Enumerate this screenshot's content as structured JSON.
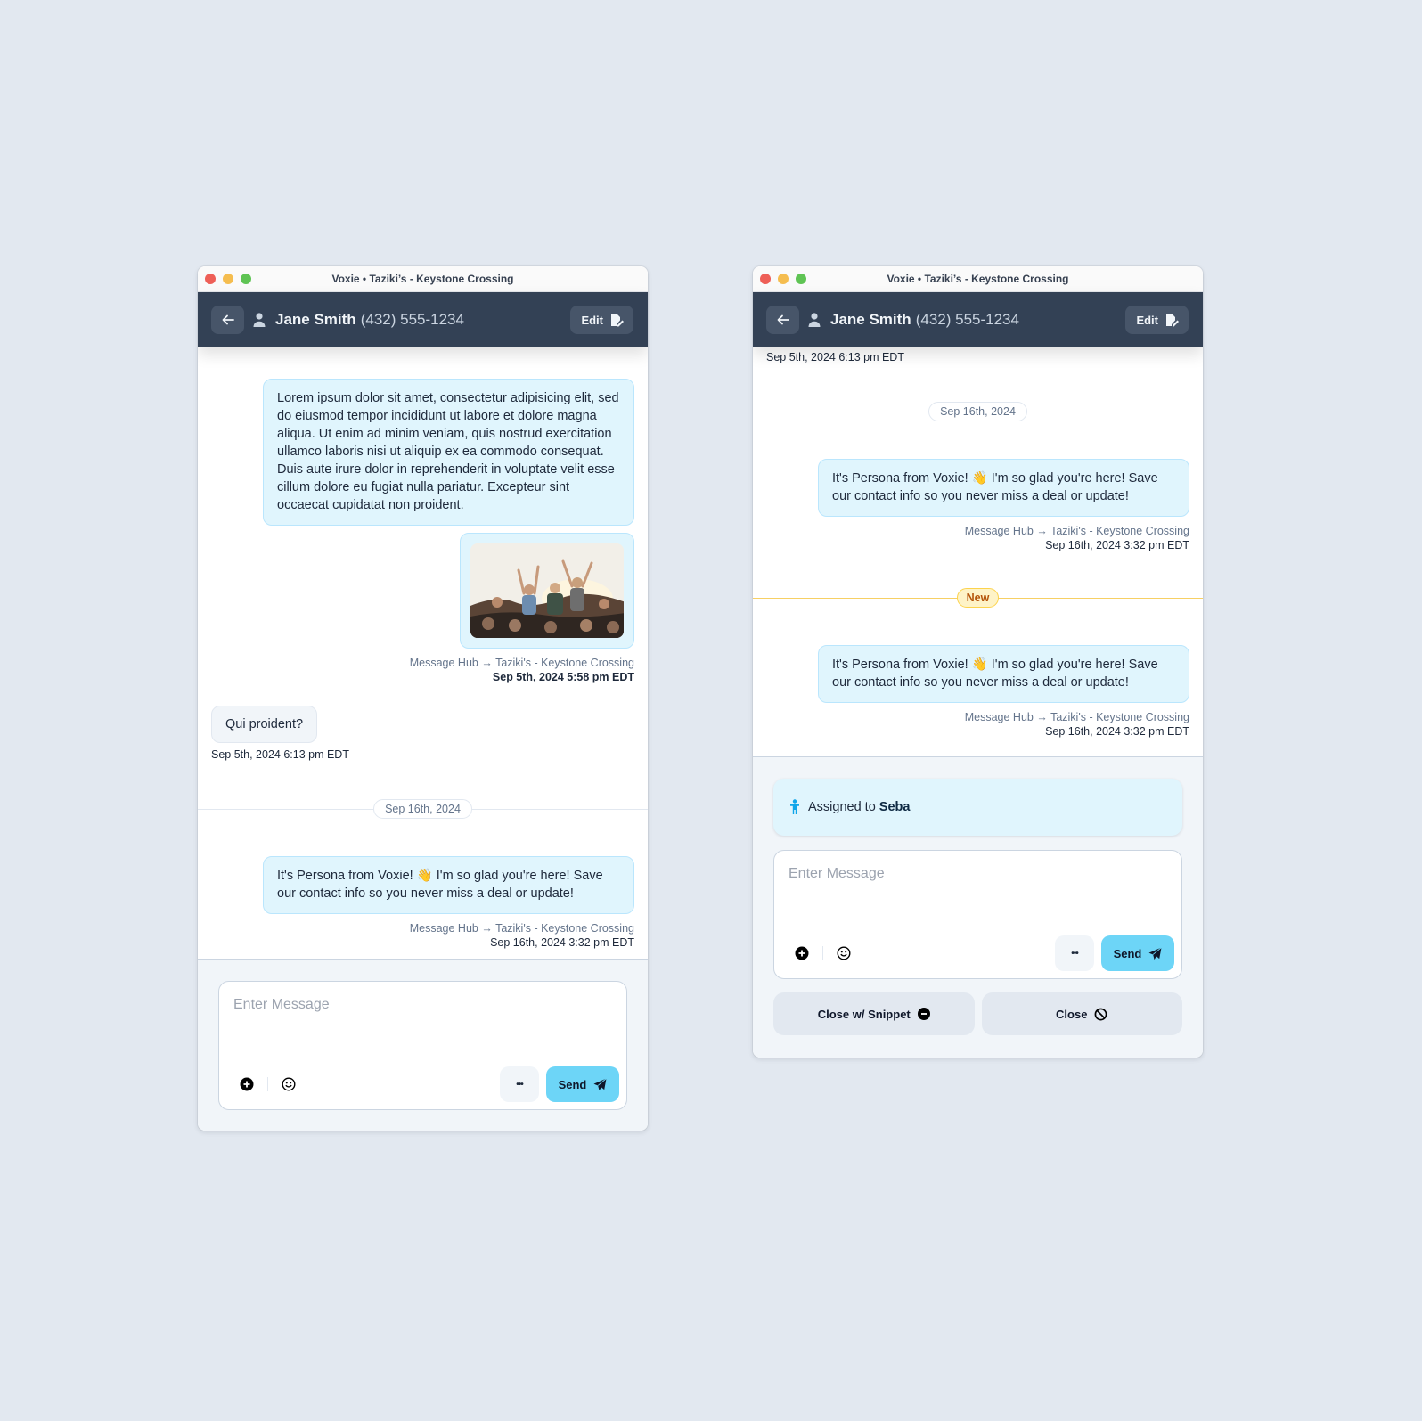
{
  "windows": [
    {
      "title": "Voxie • Taziki’s - Keystone Crossing",
      "contact": {
        "name": "Jane Smith",
        "phone": "(432) 555-1234"
      },
      "edit_label": "Edit",
      "messages": {
        "lorem": "Lorem ipsum dolor sit amet, consectetur adipisicing elit, sed do eiusmod tempor incididunt ut labore et dolore magna aliqua. Ut enim ad minim veniam, quis nostrud exercitation ullamco laboris nisi ut aliquip ex ea commodo consequat. Duis aute irure dolor in reprehenderit in voluptate velit esse cillum dolore eu fugiat nulla pariatur. Excepteur sint occaecat cupidatat non proident.",
        "image_alt": "crowd-photo",
        "group1_route": "Message Hub → Taziki's - Keystone Crossing",
        "group1_time": "Sep 5th, 2024 5:58 pm EDT",
        "incoming": "Qui proident?",
        "incoming_time": "Sep 5th, 2024 6:13 pm EDT",
        "date_separator": "Sep 16th, 2024",
        "persona": "It's Persona from Voxie! 👋 I'm so glad you're here! Save our contact info so you never miss a deal or update!",
        "persona_route": "Message Hub → Taziki's - Keystone Crossing",
        "persona_time": "Sep 16th, 2024 3:32 pm EDT"
      },
      "composer": {
        "placeholder": "Enter Message",
        "more_label": "•••",
        "send_label": "Send"
      }
    },
    {
      "title": "Voxie • Taziki’s - Keystone Crossing",
      "contact": {
        "name": "Jane Smith",
        "phone": "(432) 555-1234"
      },
      "edit_label": "Edit",
      "messages": {
        "incoming_time": "Sep 5th, 2024 6:13 pm EDT",
        "date_separator": "Sep 16th, 2024",
        "persona": "It's Persona from Voxie! 👋 I'm so glad you're here! Save our contact info so you never miss a deal or update!",
        "persona_route": "Message Hub → Taziki's - Keystone Crossing",
        "persona_time": "Sep 16th, 2024 3:32 pm EDT",
        "new_label": "New",
        "persona2": "It's Persona from Voxie! 👋 I'm so glad you're here! Save our contact info so you never miss a deal or update!",
        "persona2_route": "Message Hub → Taziki's - Keystone Crossing",
        "persona2_time": "Sep 16th, 2024 3:32 pm EDT"
      },
      "assigned": {
        "prefix": "Assigned to",
        "name": "Seba"
      },
      "composer": {
        "placeholder": "Enter Message",
        "more_label": "•••",
        "send_label": "Send"
      },
      "close_actions": {
        "snippet_label": "Close w/ Snippet",
        "close_label": "Close"
      }
    }
  ],
  "colors": {
    "header_bg": "#334155",
    "outgoing_bubble": "#e0f5fd",
    "send_button": "#6dd5f7",
    "new_badge": "#fef3c7"
  }
}
